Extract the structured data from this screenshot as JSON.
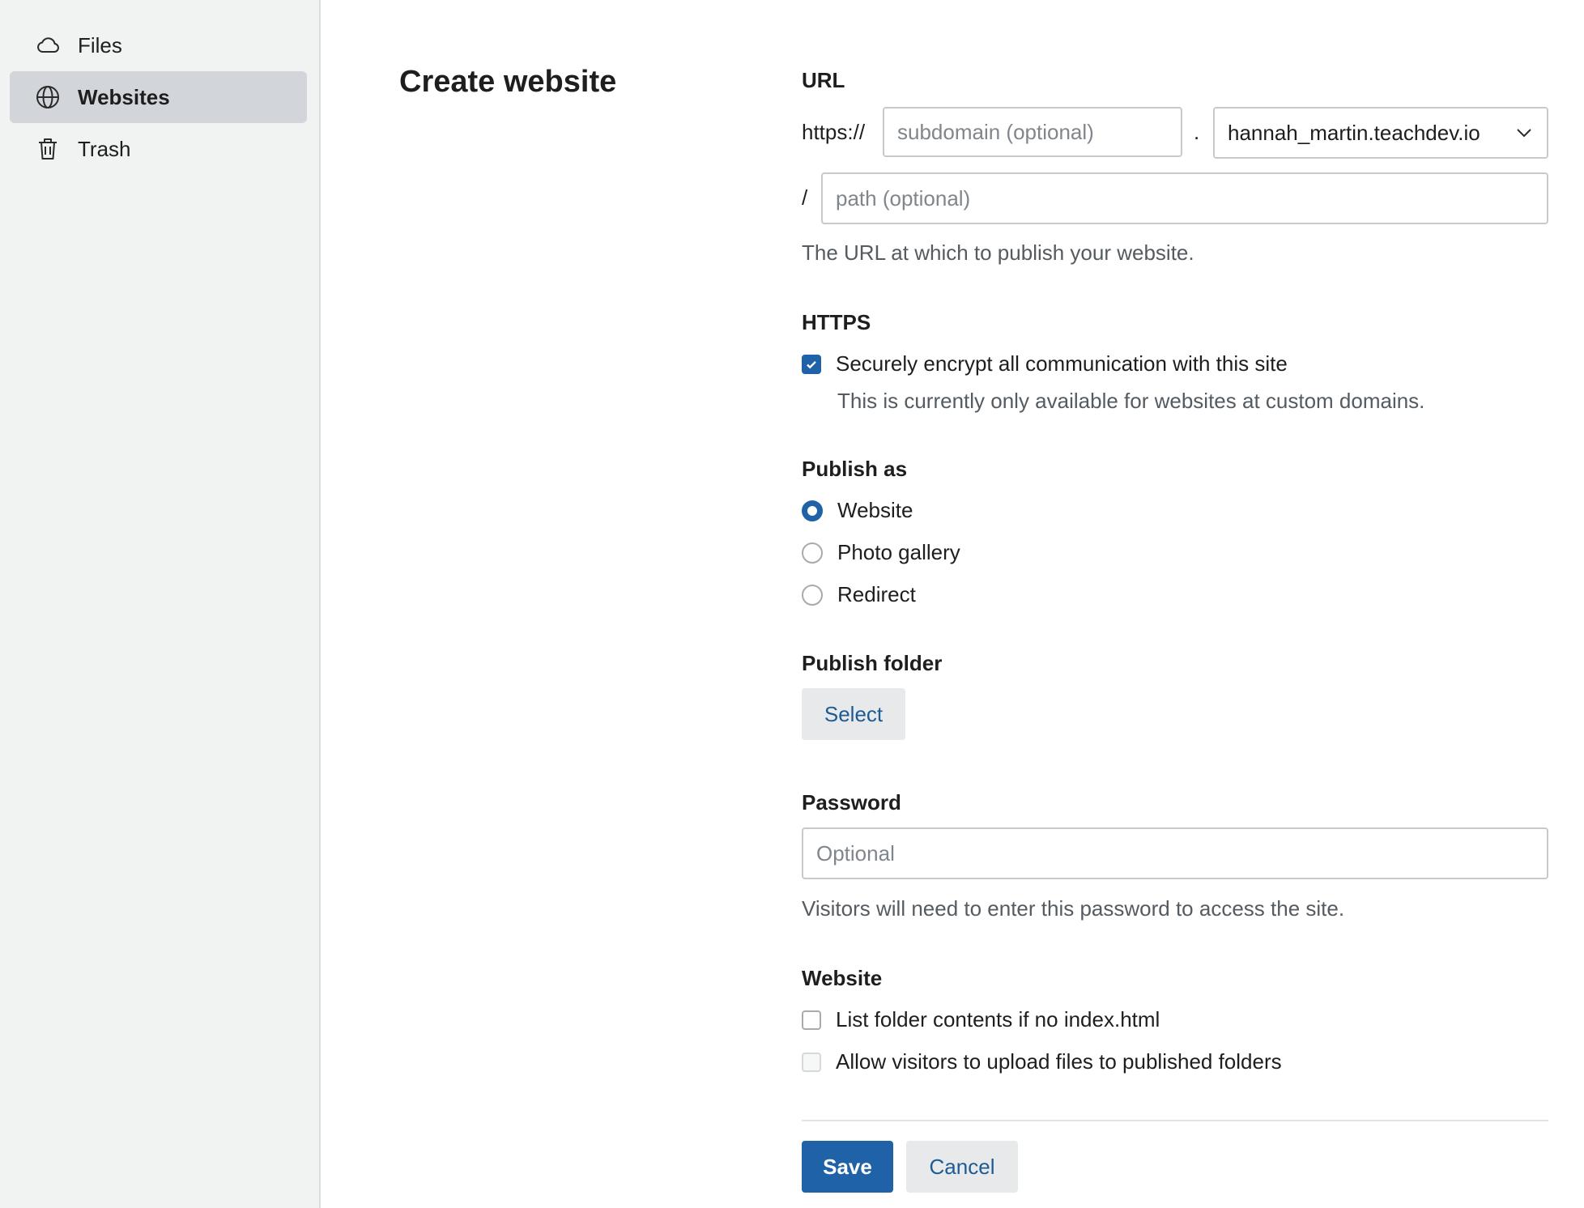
{
  "sidebar": {
    "items": [
      {
        "label": "Files",
        "icon": "cloud-icon",
        "active": false
      },
      {
        "label": "Websites",
        "icon": "globe-icon",
        "active": true
      },
      {
        "label": "Trash",
        "icon": "trash-icon",
        "active": false
      }
    ]
  },
  "page": {
    "title": "Create website"
  },
  "url_section": {
    "label": "URL",
    "scheme": "https://",
    "subdomain_placeholder": "subdomain (optional)",
    "dot": ".",
    "domain_value": "hannah_martin.teachdev.io",
    "slash": "/",
    "path_placeholder": "path (optional)",
    "help": "The URL at which to publish your website."
  },
  "https_section": {
    "label": "HTTPS",
    "checkbox_label": "Securely encrypt all communication with this site",
    "checked": true,
    "help": "This is currently only available for websites at custom domains."
  },
  "publish_as": {
    "label": "Publish as",
    "options": [
      {
        "label": "Website",
        "selected": true
      },
      {
        "label": "Photo gallery",
        "selected": false
      },
      {
        "label": "Redirect",
        "selected": false
      }
    ]
  },
  "publish_folder": {
    "label": "Publish folder",
    "button_label": "Select"
  },
  "password": {
    "label": "Password",
    "placeholder": "Optional",
    "help": "Visitors will need to enter this password to access the site."
  },
  "website_options": {
    "label": "Website",
    "options": [
      {
        "label": "List folder contents if no index.html",
        "checked": false,
        "disabled": false
      },
      {
        "label": "Allow visitors to upload files to published folders",
        "checked": false,
        "disabled": true
      }
    ]
  },
  "actions": {
    "save_label": "Save",
    "cancel_label": "Cancel"
  },
  "colors": {
    "accent": "#1f62a8",
    "sidebar_bg": "#f1f2f2",
    "active_item_bg": "#d2d6da"
  }
}
